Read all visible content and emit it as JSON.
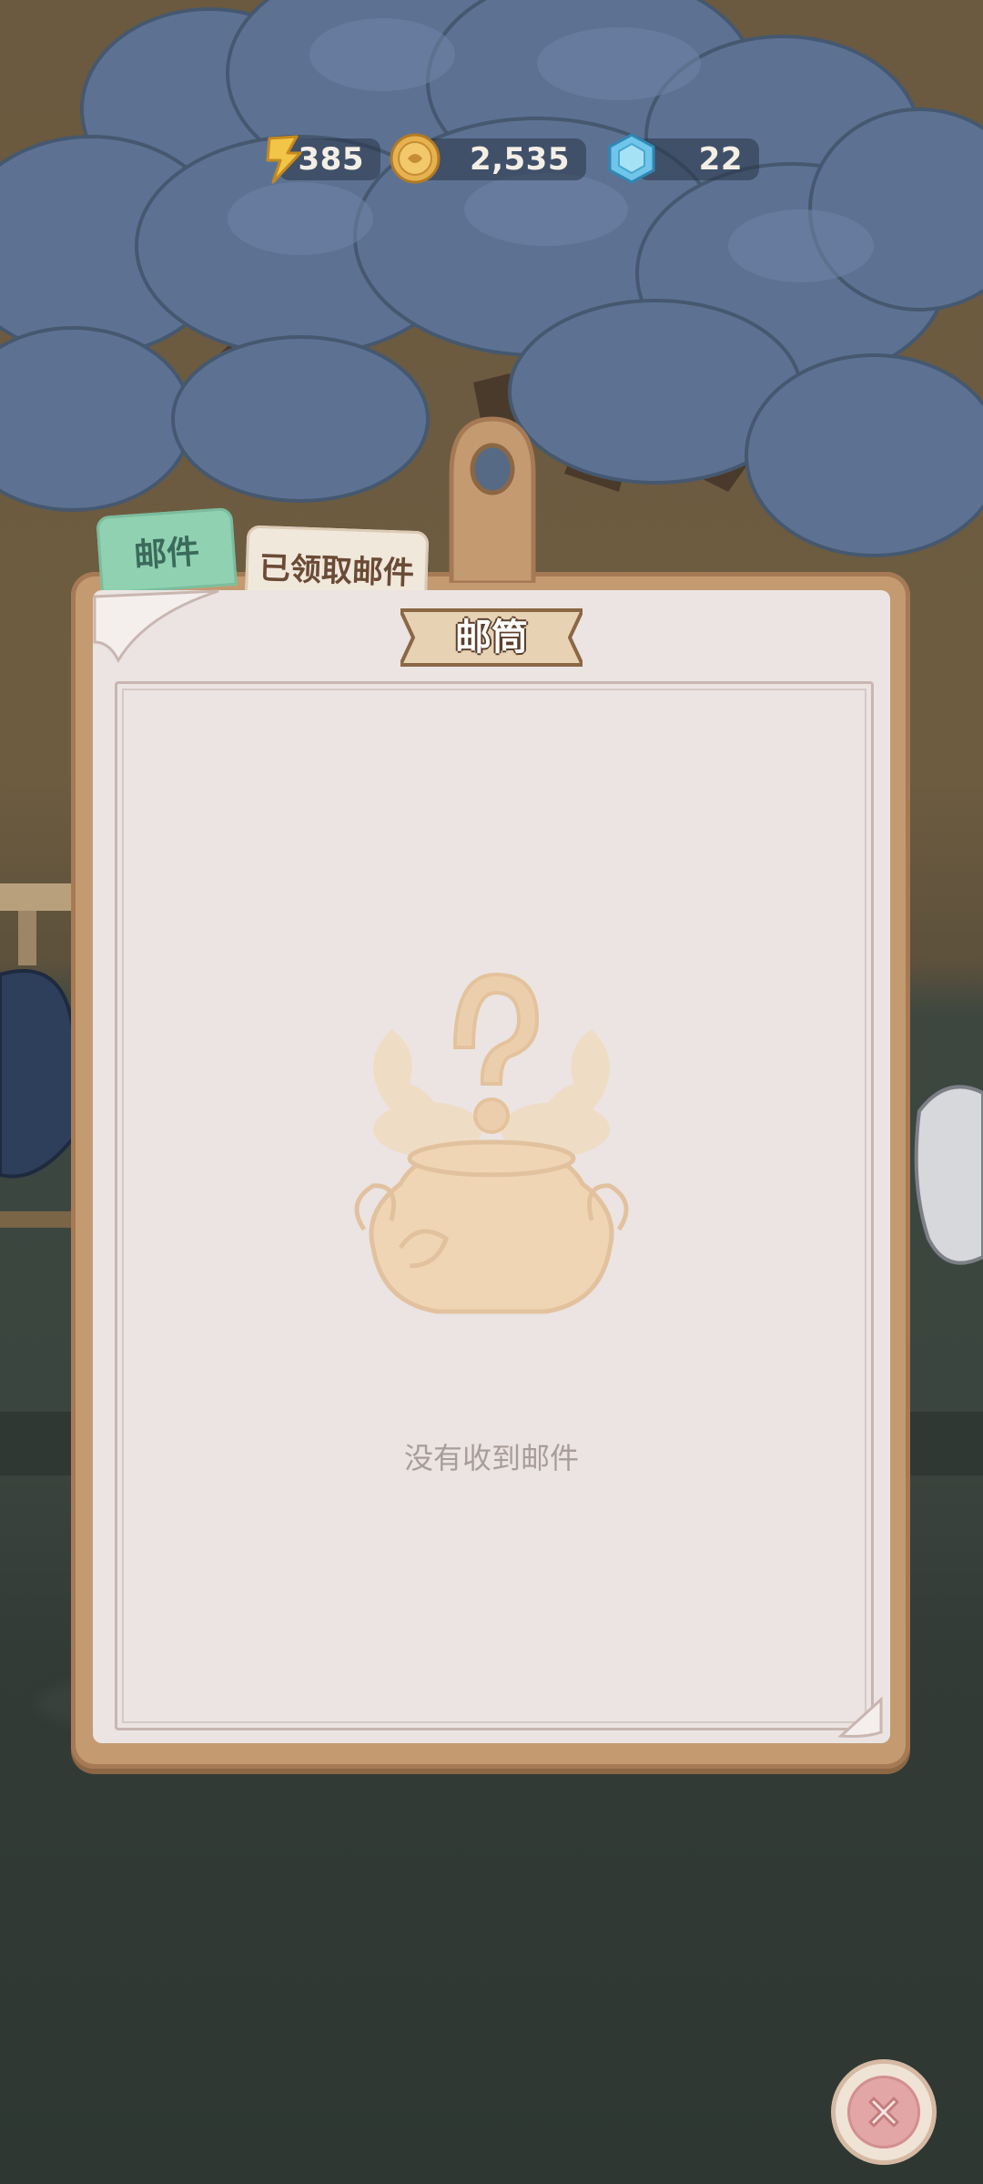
{
  "resources": {
    "energy": {
      "value": "385",
      "icon": "lightning-icon"
    },
    "coins": {
      "value": "2,535",
      "icon": "coin-icon"
    },
    "gems": {
      "value": "22",
      "icon": "gem-icon"
    }
  },
  "tabs": {
    "mail": "邮件",
    "claimed": "已领取邮件"
  },
  "panel": {
    "title": "邮筒",
    "empty_message": "没有收到邮件"
  },
  "close_button": {
    "icon": "close-icon"
  },
  "colors": {
    "board": "#c49a71",
    "paper": "#ebe4e3",
    "tab_active": "#8fd1b0",
    "tab_inactive": "#f1e8dc",
    "close_red": "#e2a6a6",
    "tree_blue": "#5d7293"
  }
}
